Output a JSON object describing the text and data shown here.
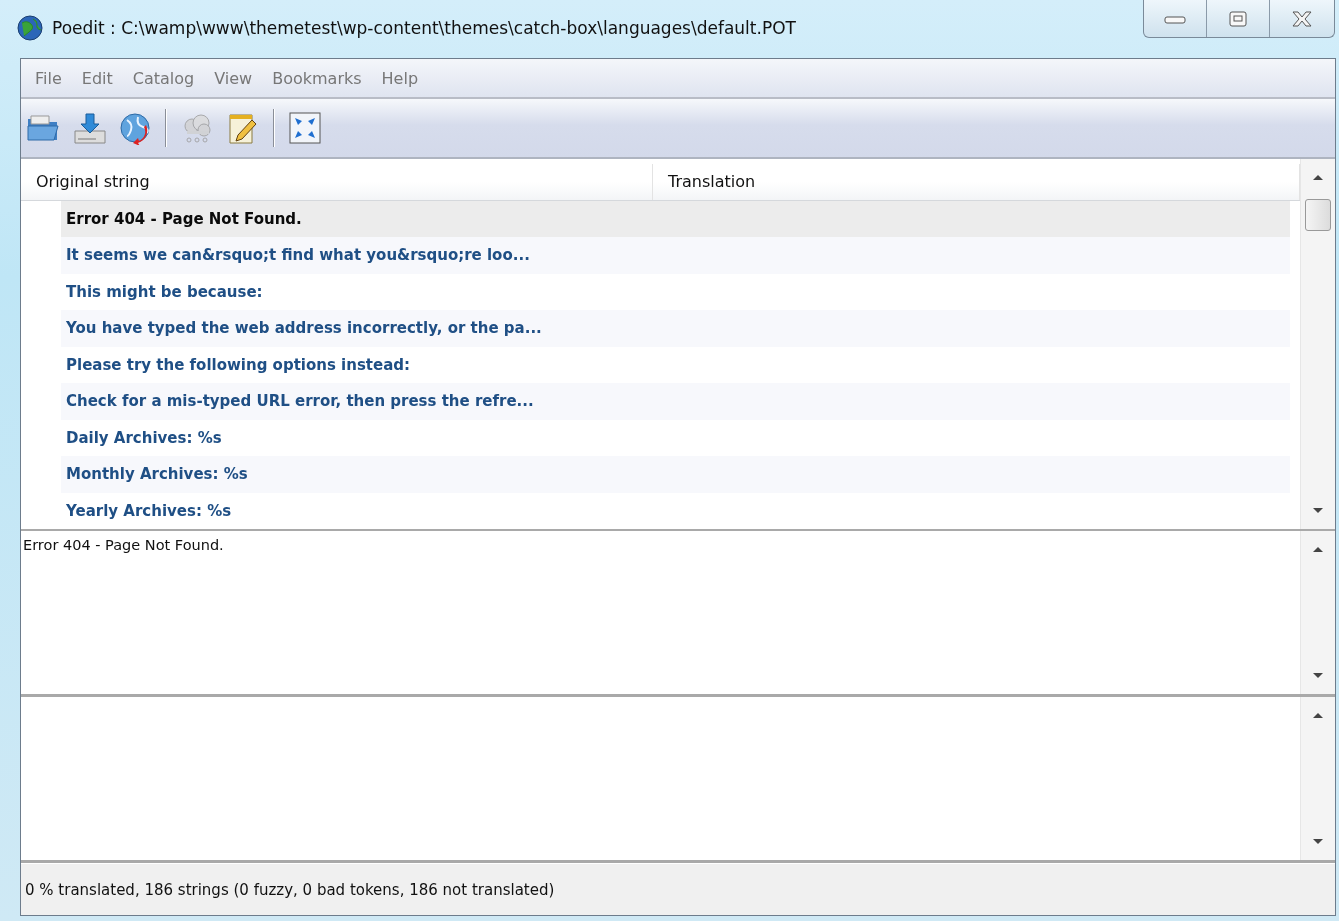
{
  "window": {
    "title": "Poedit : C:\\wamp\\www\\themetest\\wp-content\\themes\\catch-box\\languages\\default.POT"
  },
  "menu": [
    "File",
    "Edit",
    "Catalog",
    "View",
    "Bookmarks",
    "Help"
  ],
  "toolbar": {
    "groups": [
      [
        {
          "disabled": false
        },
        {
          "disabled": false
        },
        {
          "disabled": false
        }
      ],
      [
        {
          "disabled": true
        },
        {
          "disabled": false
        }
      ],
      [
        {
          "disabled": false
        }
      ]
    ]
  },
  "table": {
    "columns": [
      "Original string",
      "Translation"
    ],
    "rows": [
      {
        "original": "Error 404 - Page Not Found.",
        "selected": true
      },
      {
        "original": "It seems we can&rsquo;t find what you&rsquo;re loo...",
        "selected": false
      },
      {
        "original": "This might be because:",
        "selected": false
      },
      {
        "original": "You have typed the web address incorrectly, or the pa...",
        "selected": false
      },
      {
        "original": "Please try the following options instead:",
        "selected": false
      },
      {
        "original": "Check for a mis-typed URL error, then press the refre...",
        "selected": false
      },
      {
        "original": "Daily Archives: %s",
        "selected": false
      },
      {
        "original": "Monthly Archives: %s",
        "selected": false
      },
      {
        "original": "Yearly Archives: %s",
        "selected": false
      }
    ]
  },
  "source_text": "Error 404 - Page Not Found.",
  "status_bar": "0 % translated, 186 strings (0 fuzzy, 0 bad tokens, 186 not translated)"
}
